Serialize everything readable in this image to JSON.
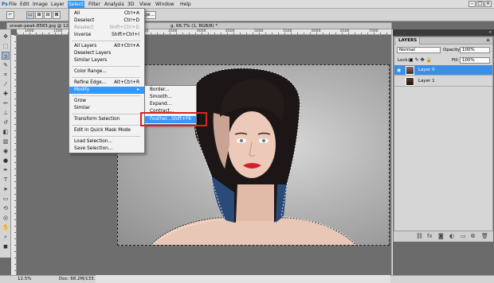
{
  "menubar": {
    "ps_logo": "Ps",
    "items": [
      "File",
      "Edit",
      "Image",
      "Layer",
      "Select",
      "Filter",
      "Analysis",
      "3D",
      "View",
      "Window",
      "Help"
    ],
    "active": "Select"
  },
  "options": {
    "refine_label": "ge..."
  },
  "document": {
    "tab_title": "sneak-peak-8583.jpg @ 12.5% (RGB/8)",
    "title_suffix": "g, 66.7% (1, RGB/8) *",
    "zoom": "12.5%",
    "doc_info": "Doc: 68.2M/133.7M",
    "ruler_labels": [
      "1000",
      "1500",
      "2000",
      "2500",
      "3000",
      "3500",
      "4000",
      "4500",
      "5000",
      "5500",
      "6000",
      "6500",
      "7000"
    ]
  },
  "select_menu": {
    "items": [
      {
        "label": "All",
        "shortcut": "Ctrl+A"
      },
      {
        "label": "Deselect",
        "shortcut": "Ctrl+D"
      },
      {
        "label": "Reselect",
        "shortcut": "Shift+Ctrl+D",
        "disabled": true
      },
      {
        "label": "Inverse",
        "shortcut": "Shift+Ctrl+I"
      },
      {
        "label": "All Layers",
        "shortcut": "Alt+Ctrl+A"
      },
      {
        "label": "Deselect Layers",
        "shortcut": ""
      },
      {
        "label": "Similar Layers",
        "shortcut": ""
      },
      {
        "label": "Color Range...",
        "shortcut": ""
      },
      {
        "label": "Refine Edge...",
        "shortcut": "Alt+Ctrl+R"
      },
      {
        "label": "Modify",
        "shortcut": "▸"
      },
      {
        "label": "Grow",
        "shortcut": ""
      },
      {
        "label": "Similar",
        "shortcut": ""
      },
      {
        "label": "Transform Selection",
        "shortcut": ""
      },
      {
        "label": "Edit in Quick Mask Mode",
        "shortcut": ""
      },
      {
        "label": "Load Selection...",
        "shortcut": ""
      },
      {
        "label": "Save Selection...",
        "shortcut": ""
      }
    ]
  },
  "modify_menu": {
    "items": [
      {
        "label": "Border...",
        "shortcut": ""
      },
      {
        "label": "Smooth...",
        "shortcut": ""
      },
      {
        "label": "Expand...",
        "shortcut": ""
      },
      {
        "label": "Contract...",
        "shortcut": ""
      },
      {
        "label": "Feather...",
        "shortcut": "Shift+F6"
      }
    ]
  },
  "layers_panel": {
    "tab": "LAYERS",
    "blend_mode": "Normal",
    "opacity_label": "Opacity:",
    "opacity_value": "100%",
    "lock_label": "Lock:",
    "fill_label": "Fill:",
    "fill_value": "100%",
    "layers": [
      {
        "name": "Layer 0",
        "selected": true
      },
      {
        "name": "Layer 1",
        "selected": false
      }
    ]
  },
  "colors": {
    "highlight": "#3399ff",
    "annotation_box": "#e02020",
    "lips": "#d81f2a"
  }
}
